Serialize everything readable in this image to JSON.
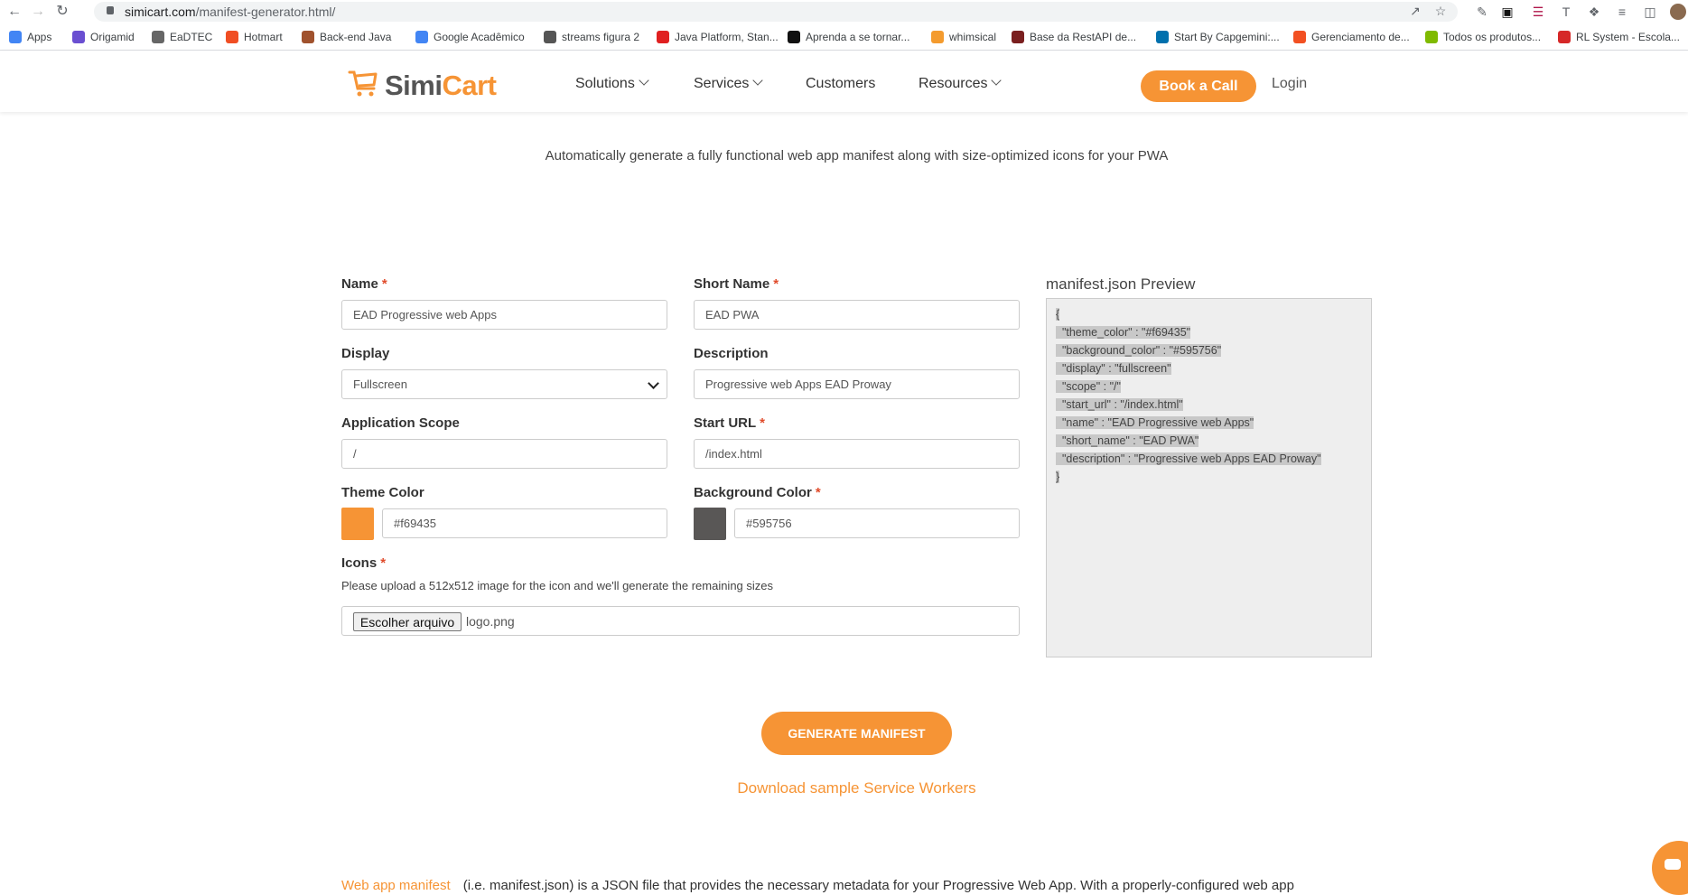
{
  "browser": {
    "url_host": "simicart.com",
    "url_path": "/manifest-generator.html/",
    "bookmarks": [
      {
        "label": "Apps",
        "color": "#4285f4"
      },
      {
        "label": "Origamid",
        "color": "#6a4fd1"
      },
      {
        "label": "EaDTEC",
        "color": "#666666"
      },
      {
        "label": "Hotmart",
        "color": "#f04e23"
      },
      {
        "label": "Back-end Java",
        "color": "#a0522d"
      },
      {
        "label": "Google Acadêmico",
        "color": "#4285f4"
      },
      {
        "label": "streams figura 2",
        "color": "#555555"
      },
      {
        "label": "Java Platform, Stan...",
        "color": "#e02020"
      },
      {
        "label": "Aprenda a se tornar...",
        "color": "#111111"
      },
      {
        "label": "whimsical",
        "color": "#f49b2e"
      },
      {
        "label": "Base da RestAPI de...",
        "color": "#7a1f1f"
      },
      {
        "label": "Start By Capgemini:...",
        "color": "#0070ad"
      },
      {
        "label": "Gerenciamento de...",
        "color": "#f25022"
      },
      {
        "label": "Todos os produtos...",
        "color": "#7fba00"
      },
      {
        "label": "RL System - Escola...",
        "color": "#d62828"
      }
    ]
  },
  "header": {
    "logo_simi": "Simi",
    "logo_cart": "Cart",
    "menu": [
      "Solutions",
      "Services",
      "Customers",
      "Resources"
    ],
    "book_call": "Book a Call",
    "login": "Login"
  },
  "tagline": "Automatically generate a fully functional web app manifest along with size-optimized icons for your PWA",
  "form": {
    "name_label": "Name",
    "name_value": "EAD Progressive web Apps",
    "short_name_label": "Short Name",
    "short_name_value": "EAD PWA",
    "display_label": "Display",
    "display_value": "Fullscreen",
    "description_label": "Description",
    "description_value": "Progressive web Apps EAD Proway",
    "scope_label": "Application Scope",
    "scope_value": "/",
    "start_url_label": "Start URL",
    "start_url_value": "/index.html",
    "theme_color_label": "Theme Color",
    "theme_color_value": "#f69435",
    "background_color_label": "Background Color",
    "background_color_value": "#595756",
    "icons_label": "Icons",
    "icons_hint": "Please upload a 512x512 image for the icon and we'll generate the remaining sizes",
    "file_button": "Escolher arquivo",
    "file_name": "logo.png",
    "required_mark": "*"
  },
  "preview": {
    "title": "manifest.json Preview",
    "lines": [
      "{",
      "  \"theme_color\" : \"#f69435\"",
      "  \"background_color\" : \"#595756\"",
      "  \"display\" : \"fullscreen\"",
      "  \"scope\" : \"/\"",
      "  \"start_url\" : \"/index.html\"",
      "  \"name\" : \"EAD Progressive web Apps\"",
      "  \"short_name\" : \"EAD PWA\"",
      "  \"description\" : \"Progressive web Apps EAD Proway\"",
      "}"
    ]
  },
  "generate_button": "GENERATE MANIFEST",
  "download_link": "Download sample Service Workers",
  "footer": {
    "link": "Web app manifest",
    "text": "(i.e. manifest.json) is a JSON file that provides the necessary metadata for your Progressive Web App. With a properly-configured web app"
  },
  "colors": {
    "accent": "#f69435",
    "theme_swatch": "#f69435",
    "background_swatch": "#595756"
  }
}
